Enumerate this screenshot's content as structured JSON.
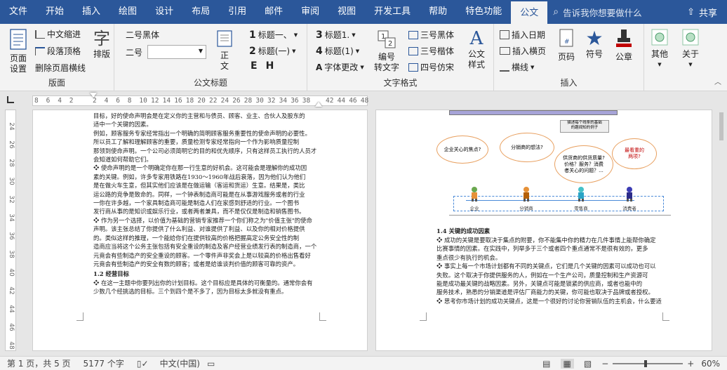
{
  "tabs": [
    "文件",
    "开始",
    "插入",
    "绘图",
    "设计",
    "布局",
    "引用",
    "邮件",
    "审阅",
    "视图",
    "开发工具",
    "帮助",
    "特色功能",
    "公文"
  ],
  "active_tab": "公文",
  "search_placeholder": "告诉我你想要做什么",
  "share_label": "共享",
  "ribbon": {
    "layout_group": {
      "label": "版面",
      "page_setup": "页面\n设置",
      "chinese_indent": "中文缩进",
      "para_top": "段落顶格",
      "delete_header_line": "删除页眉横线",
      "typeset": "排版"
    },
    "title_group": {
      "label": "公文标题",
      "font_name": "二号黑体",
      "size_label": "二号",
      "body": "正\n文",
      "h1": "标题一、",
      "h2": "标题(一)",
      "e_glyph": "E",
      "h_glyph": "H"
    },
    "text_group": {
      "label": "文字格式",
      "t1": "标题1.",
      "t2": "标题(1)",
      "font_change": "字体更改",
      "numbering": "编号\n转文字",
      "f1": "三号黑体",
      "f2": "三号楷体",
      "f3": "四号仿宋",
      "style": "公文\n样式"
    },
    "insert_group": {
      "label": "插入",
      "date": "插入日期",
      "insert_top": "插入横页",
      "line": "横线",
      "page_num": "页码",
      "symbol": "符号",
      "seal": "公章"
    },
    "other": "其他",
    "about": "关于"
  },
  "ruler_numbers": [
    "8",
    "6",
    "4",
    "2",
    "",
    "2",
    "4",
    "6",
    "8",
    "10",
    "12",
    "14",
    "16",
    "18",
    "20",
    "22",
    "24",
    "26",
    "28",
    "30",
    "32",
    "34",
    "36",
    "38",
    "",
    "42",
    "44",
    "46",
    "48"
  ],
  "vruler_numbers": [
    "24",
    "26",
    "28",
    "30",
    "32",
    "34",
    "36",
    "38",
    "40",
    "42",
    "44",
    "46",
    "48"
  ],
  "page1": {
    "lines": [
      "目标，好的使命声明会是在定义你的主营和与债员、顾客、业主、合伙人及股东的",
      "适中一个关键的因素。",
      "    例如，顾客服务专家经常指出一个明确的简明顾客服务重要性的使命声明的必要性。",
      "所以员工了解和理解顾客的重要，质量检测专家经常指向一个作为影响质量控制",
      "那领到使命声明。一个公司必须简明它的目的和优先顺序，只有这样员工执行的人员才",
      "会知道如何帮助它们。",
      "❖  使命声明的是一个明确定你在那一行生意的好机会。这可能会是理解你的成功因",
      "   素的关键。例如，许多专家用铁路在1930～1960年战后衰落，因为他们认为他们",
      "   是在做火车生意，但其实他们应该是在做运输（客运和货运）生意。结果是，类比",
      "   运公路的竞争是致命的。同样，一个钟表制造商可能是在从事游戏服务或者的行业",
      "   一你在许多越，一个家具制造商可能是制造人们在家感到舒适的行业。一个图书",
      "   发行商从事的是知识或娱乐行业，或者两者兼具，而不是仅仅是制造和销售图书。",
      "❖  作为另一个选择，以价值为基础的营销专家推荐一个你们称之为\"价值主张\"的使命",
      "   声明。该主张总结了你提供了什么利益、对谁提供了利益、以及你的相对价格提供",
      "   的。类似这样的推理，一个能给你们在提供较高的价格把握高定公务安全性的制",
      "   造商应当将这个公务主张包括有安全重设的制造及客户经营业绩发行表的制造商，一个",
      "   元竟会有些制造产的安全重设的顾客。一个零件声非奖会上是以较高的价格出售看好",
      "   元竟会有些制造产的安全有数的顾客；或者是给谁谈判价值的顾客可靠的资产。"
    ],
    "section_title": "1.2  经营目标",
    "section_lines": [
      "❖  在这一主题中你要列出你的计划目标。这个目标应是具体的可衡量的。通常你会有",
      "   少数几个经挑选的目标。三个到四个是不多了，因为目标太多就没有重点。"
    ]
  },
  "page2": {
    "chart_caption": "描述每个线条的基础\n的趣闻知的例子",
    "clouds": [
      "企业关心的焦点?",
      "分销商的想法?",
      "供货商的供货质量?\n价格？服务？消费\n者关心的问题？...",
      "最看重的\n两项?"
    ],
    "people": [
      "企业",
      "分销商",
      "零售商",
      "消费者"
    ],
    "section_title": "1.4  关键的成功因素",
    "lines": [
      "❖  成功的关键是要取决于集点的附要，你不能集中你的精力在几件事情上能帮你确定",
      "   比赛事情的因素。在实践中，列举多于三个或者四个重点通常不是很有效的，更多",
      "   重点很少有执行的机会。",
      "❖  事实上每一个市场计划都有不同的关键点，它们是几个关键的因素可以成功也可以",
      "   失败。这个取决于你提供服务的人，例如在一个生产公司，质量控制和生产资源可",
      "   能是成功最关键的战略因素。另外，关键点可能是锁紧的供应商，或者也能中的",
      "   服务技术，熟悉的分销渠道是评估厂商能力的关键，你可能也取决于品牌或者授权。",
      "❖  思考你市场计划的成功关键点，这是一个很好的讨论你营销队伍的主机会，什么要适"
    ]
  },
  "status": {
    "page": "第 1 页，共 5 页",
    "words": "5177 个字",
    "language": "中文(中国)",
    "zoom": "60%"
  }
}
